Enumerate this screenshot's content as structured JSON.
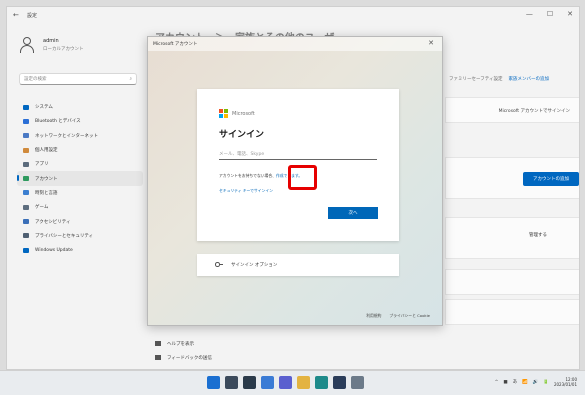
{
  "settings": {
    "app_name": "設定",
    "back_icon": "arrow-left-icon",
    "window_controls": [
      "—",
      "☐",
      "✕"
    ],
    "profile": {
      "name": "admin",
      "subtitle": "ローカルアカウント"
    },
    "search_placeholder": "設定の検索",
    "nav": [
      {
        "label": "システム",
        "icon": "system-icon",
        "color": "#0067c0"
      },
      {
        "label": "Bluetooth とデバイス",
        "icon": "bluetooth-icon",
        "color": "#2b6fd6"
      },
      {
        "label": "ネットワークとインターネット",
        "icon": "network-icon",
        "color": "#4a79c4"
      },
      {
        "label": "個人用設定",
        "icon": "brush-icon",
        "color": "#d08a3c"
      },
      {
        "label": "アプリ",
        "icon": "apps-icon",
        "color": "#5b6b7c"
      },
      {
        "label": "アカウント",
        "icon": "account-icon",
        "color": "#2e9a5e",
        "active": true
      },
      {
        "label": "時刻と言語",
        "icon": "clock-icon",
        "color": "#3b7fd0"
      },
      {
        "label": "ゲーム",
        "icon": "game-icon",
        "color": "#5d6d7e"
      },
      {
        "label": "アクセシビリティ",
        "icon": "accessibility-icon",
        "color": "#3a6fb8"
      },
      {
        "label": "プライバシーとセキュリティ",
        "icon": "shield-icon",
        "color": "#4f5f72"
      },
      {
        "label": "Windows Update",
        "icon": "update-icon",
        "color": "#0067c0"
      }
    ],
    "page_title": "アカウント　＞　家族とその他のユーザー",
    "right_links": {
      "link1": "ファミリーセーフティ設定",
      "link2": "家族メンバーの追加"
    },
    "card1_text": "Microsoft アカウントでサインイン",
    "add_account_button": "アカウントの追加",
    "manage_label": "管理する",
    "bottom_links": [
      "ヘルプを表示",
      "フィードバックの送信"
    ]
  },
  "msa": {
    "title": "Microsoft アカウント",
    "close_icon": "✕",
    "logo_text": "Microsoft",
    "heading": "サインイン",
    "email_placeholder": "メール、電話、Skype",
    "no_account_text": "アカウントをお持ちでない場合、",
    "create_link": "作成できます。",
    "options_link": "セキュリティ キーでサインイン",
    "next_button": "次へ",
    "signin_options": "サインイン オプション",
    "footer": [
      "利用規約",
      "プライバシーと Cookie"
    ]
  },
  "taskbar": {
    "icons": [
      {
        "name": "start-icon",
        "color": "#1a6fd1"
      },
      {
        "name": "search-icon",
        "color": "#3b4a5c"
      },
      {
        "name": "task-view-icon",
        "color": "#2a3a4a"
      },
      {
        "name": "widgets-icon",
        "color": "#3a7bd5"
      },
      {
        "name": "chat-icon",
        "color": "#5a5fcf"
      },
      {
        "name": "file-explorer-icon",
        "color": "#e3b341"
      },
      {
        "name": "edge-icon",
        "color": "#1d8a8a"
      },
      {
        "name": "store-icon",
        "color": "#2b3d5a"
      },
      {
        "name": "settings-icon",
        "color": "#6c7a89"
      }
    ],
    "tray": [
      "^",
      "■",
      "あ",
      "📶",
      "🔊",
      "🔋"
    ],
    "time": "12:00",
    "date": "2023/01/01"
  }
}
